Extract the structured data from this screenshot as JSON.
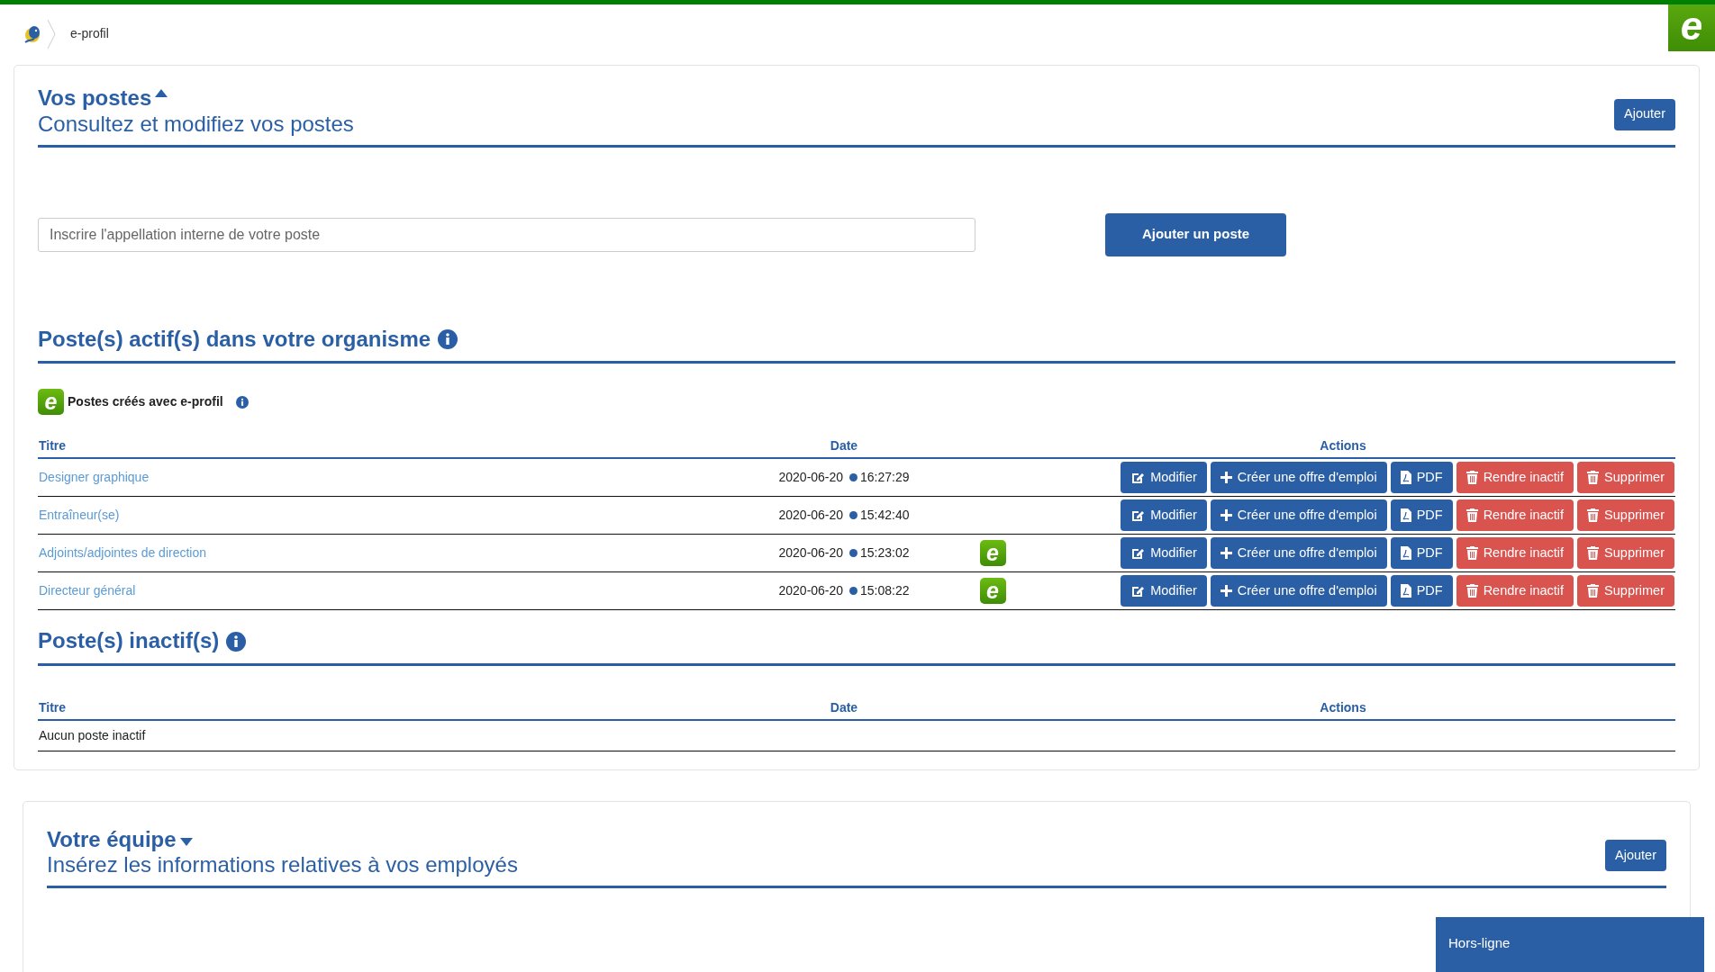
{
  "header": {
    "breadcrumb": "e-profil",
    "brand_mark": "e"
  },
  "postes": {
    "title": "Vos postes",
    "expanded": true,
    "subtitle": "Consultez et modifiez vos postes",
    "add_button": "Ajouter",
    "new_field": {
      "placeholder": "Inscrire l'appellation interne de votre poste"
    },
    "new_button": "Ajouter un poste",
    "active": {
      "title": "Poste(s) actif(s) dans votre organisme",
      "legend_badge": "e",
      "legend": "Postes créés avec e-profil",
      "columns": [
        "Titre",
        "Date",
        "Actions"
      ],
      "rows": [
        {
          "title": "Designer graphique",
          "date": "2020-06-20",
          "time": "16:27:29",
          "actions": [
            "Modifier",
            "Créer une offre d'emploi",
            "PDF",
            "Rendre inactif",
            "Supprimer"
          ]
        },
        {
          "title": "Entraîneur(se)",
          "date": "2020-06-20",
          "time": "15:42:40",
          "actions": [
            "Modifier",
            "Créer une offre d'emploi",
            "PDF",
            "Rendre inactif",
            "Supprimer"
          ]
        },
        {
          "title": "Adjoints/adjointes de direction",
          "date": "2020-06-20",
          "time": "15:23:02",
          "badge": "e",
          "actions": [
            "Modifier",
            "Créer une offre d'emploi",
            "PDF",
            "Rendre inactif",
            "Supprimer"
          ]
        },
        {
          "title": "Directeur général",
          "date": "2020-06-20",
          "time": "15:08:22",
          "badge": "e",
          "actions": [
            "Modifier",
            "Créer une offre d'emploi",
            "PDF",
            "Rendre inactif",
            "Supprimer"
          ]
        }
      ]
    },
    "inactive": {
      "title": "Poste(s) inactif(s)",
      "columns": [
        "Titre",
        "Date",
        "Actions"
      ],
      "empty": "Aucun poste inactif"
    }
  },
  "equipe": {
    "title": "Votre équipe",
    "expanded": false,
    "subtitle": "Insérez les informations relatives à vos employés",
    "add_button": "Ajouter"
  },
  "status_panel": "Hors-ligne"
}
